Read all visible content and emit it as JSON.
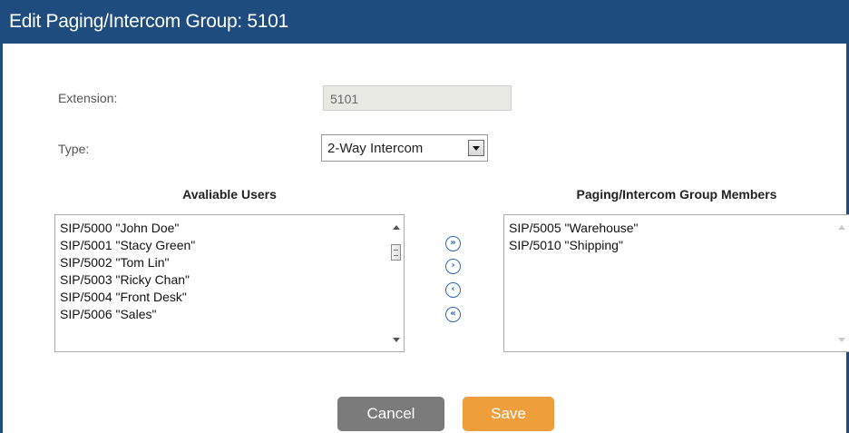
{
  "dialog": {
    "title": "Edit Paging/Intercom Group: 5101"
  },
  "form": {
    "extension_label": "Extension:",
    "extension_value": "5101",
    "type_label": "Type:",
    "type_value": "2-Way Intercom"
  },
  "available": {
    "heading": "Avaliable Users",
    "items": [
      "SIP/5000 \"John Doe\"",
      "SIP/5001 \"Stacy Green\"",
      "SIP/5002 \"Tom Lin\"",
      "SIP/5003 \"Ricky Chan\"",
      "SIP/5004 \"Front Desk\"",
      "SIP/5006 \"Sales\""
    ]
  },
  "members": {
    "heading": "Paging/Intercom Group Members",
    "items": [
      "SIP/5005 \"Warehouse\"",
      "SIP/5010 \"Shipping\""
    ]
  },
  "move_buttons": {
    "all_right": "»",
    "right": "›",
    "left": "‹",
    "all_left": "«"
  },
  "icons": {
    "move_all_right": "move-all-right-icon",
    "move_right": "move-right-icon",
    "move_left": "move-left-icon",
    "move_all_left": "move-all-left-icon"
  },
  "actions": {
    "cancel_label": "Cancel",
    "save_label": "Save"
  },
  "colors": {
    "header": "#1e4c7e",
    "save": "#ee9f3c",
    "cancel": "#7b7b7b",
    "move_icon": "#2a67b5"
  }
}
